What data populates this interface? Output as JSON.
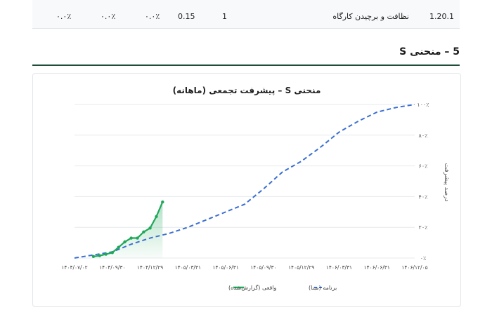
{
  "table": {
    "row": {
      "code": "1.20.1",
      "description": "نظافت و برچیدن کارگاه",
      "count": "1",
      "weight": "0.15",
      "p1": "۰.۰٪",
      "p2": "۰.۰٪",
      "p3": "۰.۰٪"
    }
  },
  "section": {
    "title": "5 – منحنی S"
  },
  "chart_data": {
    "type": "line",
    "title": "منحنی S – پیشرفت تجمعی (ماهانه)",
    "ylabel": "درصد پیشرفت",
    "ylim": [
      0,
      100
    ],
    "y_ticks": [
      "۰٪",
      "۲۰٪",
      "۴۰٪",
      "۶۰٪",
      "۸۰٪",
      "۱۰۰٪"
    ],
    "x_ticks": [
      "۱۴۰۴/۰۷/۰۲",
      "۱۴۰۴/۰۹/۳۰",
      "۱۴۰۴/۱۲/۲۹",
      "۱۴۰۵/۰۳/۳۱",
      "۱۴۰۵/۰۶/۳۱",
      "۱۴۰۵/۰۹/۳۰",
      "۱۴۰۵/۱۲/۲۹",
      "۱۴۰۶/۰۳/۳۱",
      "۱۴۰۶/۰۶/۳۱",
      "۱۴۰۶/۱۲/۰۵"
    ],
    "grid": true,
    "legend_position": "bottom",
    "series": [
      {
        "name": "برنامه (مبنا)",
        "color": "#3b6fd1",
        "style": "dashed",
        "values": [
          {
            "x": 0,
            "y": 0
          },
          {
            "x": 1,
            "y": 2
          },
          {
            "x": 2,
            "y": 4
          },
          {
            "x": 3,
            "y": 9
          },
          {
            "x": 4,
            "y": 13
          },
          {
            "x": 5,
            "y": 16
          },
          {
            "x": 6,
            "y": 20
          },
          {
            "x": 7,
            "y": 25
          },
          {
            "x": 8,
            "y": 30
          },
          {
            "x": 9,
            "y": 35
          },
          {
            "x": 10,
            "y": 45
          },
          {
            "x": 11,
            "y": 56
          },
          {
            "x": 12,
            "y": 63
          },
          {
            "x": 13,
            "y": 72
          },
          {
            "x": 14,
            "y": 82
          },
          {
            "x": 15,
            "y": 89
          },
          {
            "x": 16,
            "y": 95
          },
          {
            "x": 17,
            "y": 98
          },
          {
            "x": 18,
            "y": 100
          }
        ]
      },
      {
        "name": "واقعی (گزارش‌شده)",
        "color": "#1fa85a",
        "style": "solid",
        "values": [
          {
            "x": 1.0,
            "y": 1
          },
          {
            "x": 1.33,
            "y": 1.5
          },
          {
            "x": 1.66,
            "y": 2.5
          },
          {
            "x": 2.0,
            "y": 3.5
          },
          {
            "x": 2.33,
            "y": 7
          },
          {
            "x": 2.66,
            "y": 10.5
          },
          {
            "x": 3.0,
            "y": 13
          },
          {
            "x": 3.33,
            "y": 13
          },
          {
            "x": 3.66,
            "y": 17
          },
          {
            "x": 4.0,
            "y": 19.5
          },
          {
            "x": 4.33,
            "y": 27
          },
          {
            "x": 4.66,
            "y": 36.5
          }
        ]
      }
    ],
    "x_index_range": [
      0,
      18
    ]
  }
}
